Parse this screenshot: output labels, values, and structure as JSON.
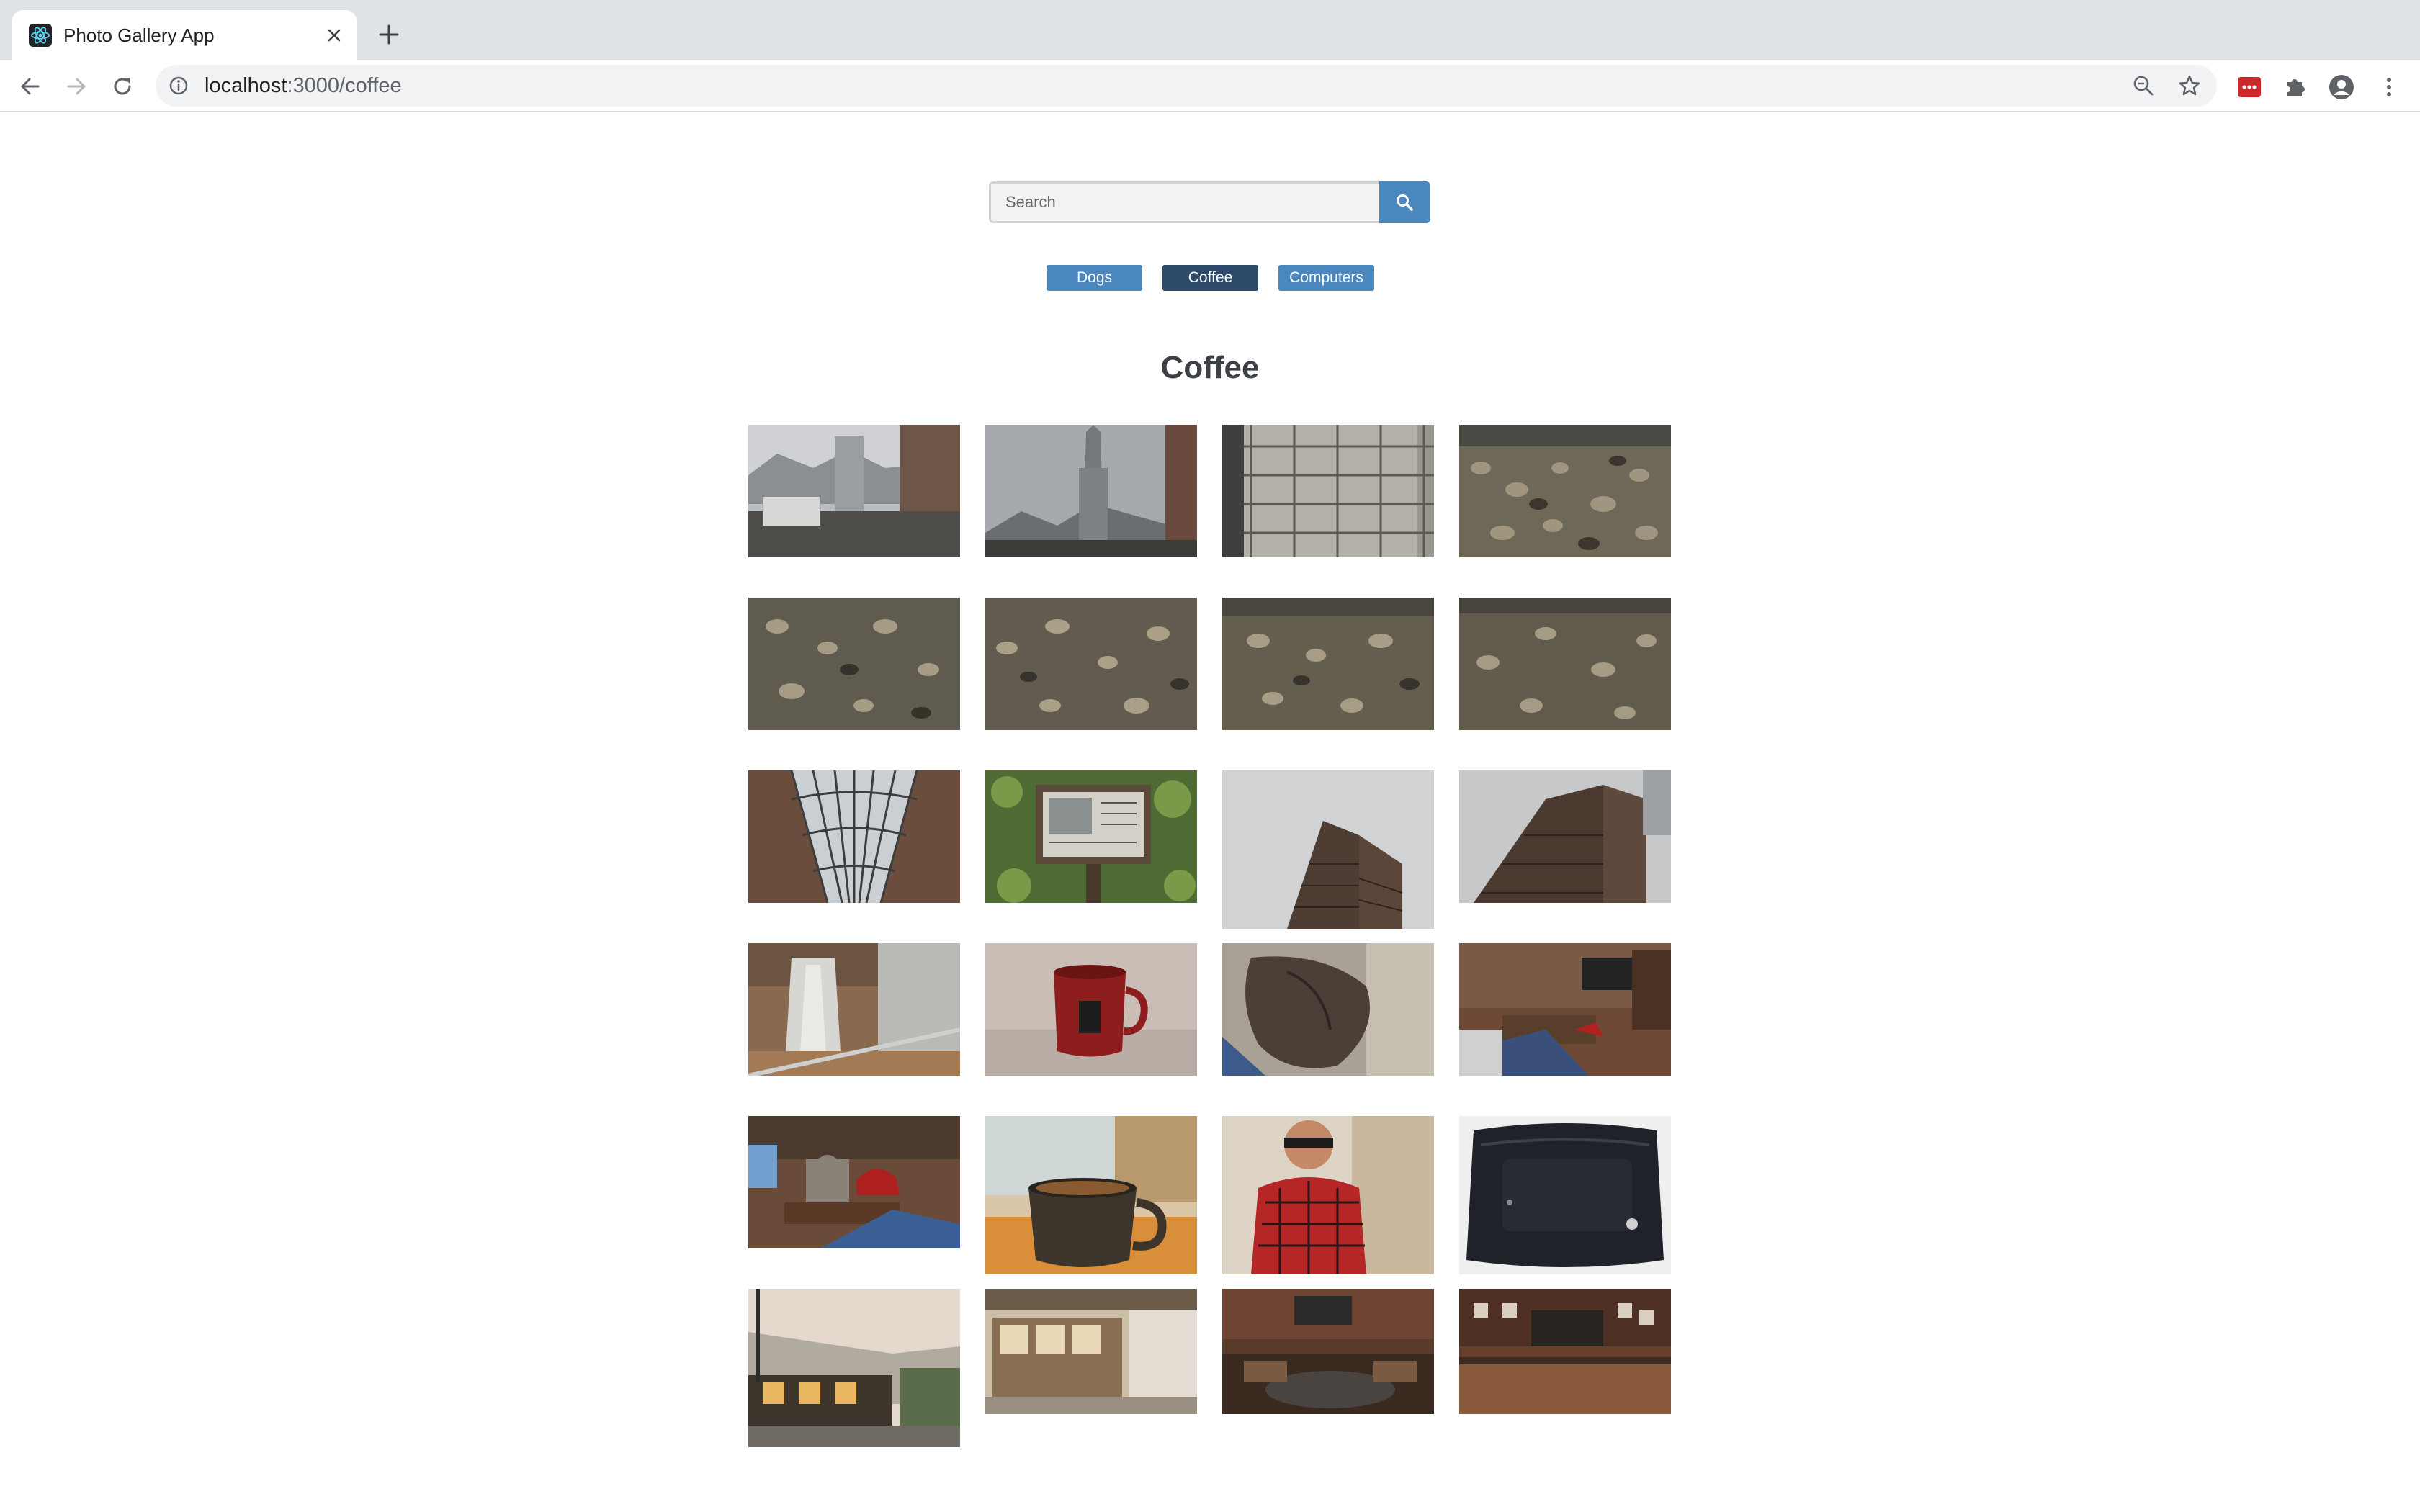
{
  "browser": {
    "tab_title": "Photo Gallery App",
    "url_host": "localhost",
    "url_path": ":3000/coffee"
  },
  "search": {
    "placeholder": "Search"
  },
  "categories": [
    {
      "label": "Dogs",
      "active": false
    },
    {
      "label": "Coffee",
      "active": true
    },
    {
      "label": "Computers",
      "active": false
    }
  ],
  "heading": "Coffee",
  "colors": {
    "accent": "#4a87be",
    "active": "#2e4a6a",
    "heading": "#3d4047"
  },
  "photos": [
    {
      "subject": "cathedral-street",
      "aspect": "landscape"
    },
    {
      "subject": "cathedral-spire",
      "aspect": "landscape"
    },
    {
      "subject": "scaffolded-building",
      "aspect": "landscape"
    },
    {
      "subject": "pebbles",
      "aspect": "landscape"
    },
    {
      "subject": "pebbles",
      "aspect": "landscape"
    },
    {
      "subject": "pebbles",
      "aspect": "landscape"
    },
    {
      "subject": "pebbles",
      "aspect": "landscape"
    },
    {
      "subject": "pebbles",
      "aspect": "landscape"
    },
    {
      "subject": "glass-arcade-roof",
      "aspect": "landscape"
    },
    {
      "subject": "trail-sign",
      "aspect": "landscape"
    },
    {
      "subject": "skyscraper",
      "aspect": "tall"
    },
    {
      "subject": "skyscraper-sky",
      "aspect": "landscape"
    },
    {
      "subject": "waterfall",
      "aspect": "landscape"
    },
    {
      "subject": "red-mug",
      "aspect": "landscape"
    },
    {
      "subject": "leather-jacket",
      "aspect": "landscape"
    },
    {
      "subject": "living-room",
      "aspect": "landscape"
    },
    {
      "subject": "cat-red-shoes",
      "aspect": "landscape"
    },
    {
      "subject": "coffee-cup",
      "aspect": "tall"
    },
    {
      "subject": "man-plaid-shirt",
      "aspect": "tall"
    },
    {
      "subject": "black-bag",
      "aspect": "tall"
    },
    {
      "subject": "street-cafe",
      "aspect": "taller"
    },
    {
      "subject": "cafe-storefront",
      "aspect": "medium"
    },
    {
      "subject": "cafe-interior",
      "aspect": "medium"
    },
    {
      "subject": "coffee-bar",
      "aspect": "medium"
    }
  ]
}
